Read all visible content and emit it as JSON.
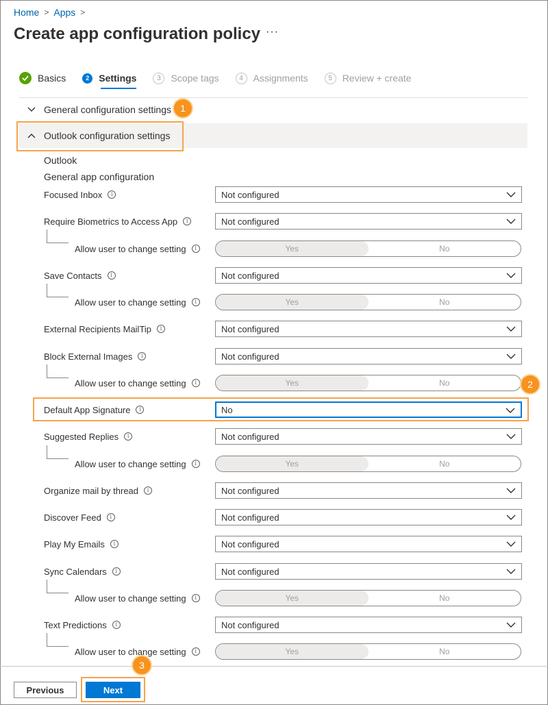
{
  "breadcrumb": {
    "home": "Home",
    "apps": "Apps",
    "sep": ">"
  },
  "page": {
    "title": "Create app configuration policy",
    "more": "···"
  },
  "steps": [
    {
      "num": "",
      "label": "Basics",
      "state": "done"
    },
    {
      "num": "2",
      "label": "Settings",
      "state": "active"
    },
    {
      "num": "3",
      "label": "Scope tags",
      "state": "todo"
    },
    {
      "num": "4",
      "label": "Assignments",
      "state": "todo"
    },
    {
      "num": "5",
      "label": "Review + create",
      "state": "todo"
    }
  ],
  "sections": {
    "general": "General configuration settings",
    "outlook": "Outlook configuration settings"
  },
  "outlook_heading": "Outlook",
  "general_app_heading": "General app configuration",
  "settings": [
    {
      "label": "Focused Inbox",
      "value": "Not configured"
    },
    {
      "label": "Require Biometrics to Access App",
      "value": "Not configured"
    },
    {
      "label": "Save Contacts",
      "value": "Not configured"
    },
    {
      "label": "External Recipients MailTip",
      "value": "Not configured"
    },
    {
      "label": "Block External Images",
      "value": "Not configured"
    },
    {
      "label": "Default App Signature",
      "value": "No"
    },
    {
      "label": "Suggested Replies",
      "value": "Not configured"
    },
    {
      "label": "Organize mail by thread",
      "value": "Not configured"
    },
    {
      "label": "Discover Feed",
      "value": "Not configured"
    },
    {
      "label": "Play My Emails",
      "value": "Not configured"
    },
    {
      "label": "Sync Calendars",
      "value": "Not configured"
    },
    {
      "label": "Text Predictions",
      "value": "Not configured"
    }
  ],
  "allow_change_label": "Allow user to change setting",
  "toggle": {
    "yes": "Yes",
    "no": "No",
    "selected": "Yes"
  },
  "info_glyph": "i",
  "callouts": [
    "1",
    "2",
    "3"
  ],
  "buttons": {
    "previous": "Previous",
    "next": "Next"
  },
  "colors": {
    "accent": "#0078d4",
    "link": "#0062ad",
    "success": "#57a300",
    "callout": "#f7931e",
    "section_bg": "#f3f2f1"
  }
}
